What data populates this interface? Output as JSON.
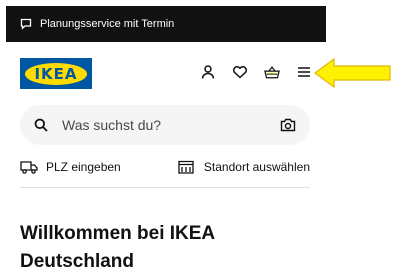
{
  "topbar": {
    "text": "Planungsservice mit Termin",
    "icon": "chat-icon"
  },
  "header": {
    "logo_text": "IKEA",
    "icons": [
      "user-icon",
      "heart-icon",
      "basket-icon",
      "menu-icon"
    ]
  },
  "colors": {
    "brand_blue": "#0058a3",
    "brand_yellow": "#ffdb00",
    "arrow_yellow": "#fff200",
    "topbar_bg": "#111111"
  },
  "search": {
    "placeholder": "Was suchst du?"
  },
  "links": {
    "zip": "PLZ eingeben",
    "store": "Standort auswählen"
  },
  "welcome": {
    "line1": "Willkommen bei IKEA",
    "line2": "Deutschland"
  }
}
